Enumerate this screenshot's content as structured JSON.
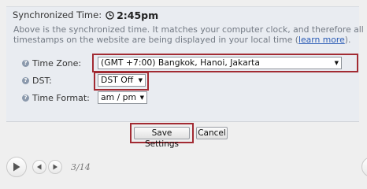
{
  "sync": {
    "label": "Synchronized Time:",
    "time": "2:45pm",
    "note_line1": "Above is the synchronized time. It matches your computer clock, and therefore all",
    "note_line2_prefix": "timestamps on the website are being displayed in your local time (",
    "note_link": "learn more",
    "note_line2_suffix": ")."
  },
  "settings": {
    "timezone": {
      "label": "Time Zone:",
      "value": "(GMT +7:00) Bangkok, Hanoi, Jakarta"
    },
    "dst": {
      "label": "DST:",
      "value": "DST Off"
    },
    "time_format": {
      "label": "Time Format:",
      "value": "am / pm"
    }
  },
  "buttons": {
    "save": "Save Settings",
    "cancel": "Cancel"
  },
  "player": {
    "counter": "3/14"
  },
  "highlight_color": "#a22b33"
}
